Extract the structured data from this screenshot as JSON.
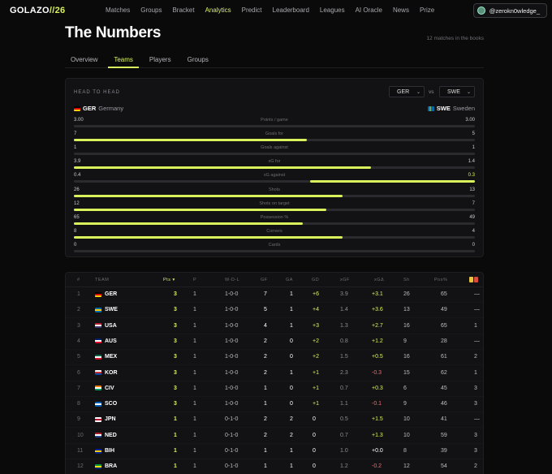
{
  "brand": {
    "main": "GOLAZO",
    "accent": "//26"
  },
  "nav": [
    "Matches",
    "Groups",
    "Bracket",
    "Analytics",
    "Predict",
    "Leaderboard",
    "Leagues",
    "AI Oracle",
    "News",
    "Prize"
  ],
  "nav_active": "Analytics",
  "user": {
    "handle": "@zerokn0wledge_"
  },
  "page": {
    "title": "The Numbers",
    "subtitle": "12 matches in the books"
  },
  "tabs": [
    "Overview",
    "Teams",
    "Players",
    "Groups"
  ],
  "tab_active": "Teams",
  "h2h": {
    "label": "HEAD TO HEAD",
    "vs": "vs",
    "left": {
      "code": "GER",
      "name": "Germany",
      "select": "GER"
    },
    "right": {
      "code": "SWE",
      "name": "Sweden",
      "select": "SWE"
    },
    "stats": [
      {
        "label": "Points / game",
        "left": "3.00",
        "right": "3.00",
        "left_share": 0.5,
        "right_share": 0.5,
        "highlight": "none"
      },
      {
        "label": "Goals for",
        "left": "7",
        "right": "5",
        "left_share": 0.58,
        "right_share": 0.42,
        "highlight": "left"
      },
      {
        "label": "Goals against",
        "left": "1",
        "right": "1",
        "left_share": 0.5,
        "right_share": 0.5,
        "highlight": "none"
      },
      {
        "label": "xG for",
        "left": "3.9",
        "right": "1.4",
        "left_share": 0.74,
        "right_share": 0.26,
        "highlight": "left"
      },
      {
        "label": "xG against",
        "left": "0.4",
        "right": "0.3",
        "left_share": 0.59,
        "right_share": 0.41,
        "highlight": "right"
      },
      {
        "label": "Shots",
        "left": "26",
        "right": "13",
        "left_share": 0.67,
        "right_share": 0.33,
        "highlight": "left"
      },
      {
        "label": "Shots on target",
        "left": "12",
        "right": "7",
        "left_share": 0.63,
        "right_share": 0.37,
        "highlight": "left"
      },
      {
        "label": "Possession %",
        "left": "65",
        "right": "49",
        "left_share": 0.57,
        "right_share": 0.43,
        "highlight": "left"
      },
      {
        "label": "Corners",
        "left": "8",
        "right": "4",
        "left_share": 0.67,
        "right_share": 0.33,
        "highlight": "left"
      },
      {
        "label": "Cards",
        "left": "0",
        "right": "0",
        "left_share": 0.5,
        "right_share": 0.5,
        "highlight": "none"
      }
    ]
  },
  "table": {
    "headers": {
      "rank": "#",
      "team": "TEAM",
      "pts": "Pts ▾",
      "p": "P",
      "wdl": "W-D-L",
      "gf": "GF",
      "ga": "GA",
      "gd": "GD",
      "xgf": "xGF",
      "xgd": "xGΔ",
      "sh": "Sh",
      "pos": "Pos%"
    },
    "rows": [
      {
        "rank": "1",
        "code": "GER",
        "flag": [
          "#000000",
          "#dd0000",
          "#ffce00"
        ],
        "pts": "3",
        "p": "1",
        "wdl": "1-0-0",
        "gf": "7",
        "ga": "1",
        "gd": "+6",
        "xgf": "3.9",
        "xgd": "+3.1",
        "sh": "26",
        "pos": "65",
        "cards": "—"
      },
      {
        "rank": "2",
        "code": "SWE",
        "flag": [
          "#006aa7",
          "#fecc00",
          "#006aa7"
        ],
        "pts": "3",
        "p": "1",
        "wdl": "1-0-0",
        "gf": "5",
        "ga": "1",
        "gd": "+4",
        "xgf": "1.4",
        "xgd": "+3.6",
        "sh": "13",
        "pos": "49",
        "cards": "—"
      },
      {
        "rank": "3",
        "code": "USA",
        "flag": [
          "#b22234",
          "#ffffff",
          "#3c3b6e"
        ],
        "pts": "3",
        "p": "1",
        "wdl": "1-0-0",
        "gf": "4",
        "ga": "1",
        "gd": "+3",
        "xgf": "1.3",
        "xgd": "+2.7",
        "sh": "16",
        "pos": "65",
        "cards": "1"
      },
      {
        "rank": "4",
        "code": "AUS",
        "flag": [
          "#012169",
          "#ffffff",
          "#e4002b"
        ],
        "pts": "3",
        "p": "1",
        "wdl": "1-0-0",
        "gf": "2",
        "ga": "0",
        "gd": "+2",
        "xgf": "0.8",
        "xgd": "+1.2",
        "sh": "9",
        "pos": "28",
        "cards": "—"
      },
      {
        "rank": "5",
        "code": "MEX",
        "flag": [
          "#006847",
          "#ffffff",
          "#ce1126"
        ],
        "pts": "3",
        "p": "1",
        "wdl": "1-0-0",
        "gf": "2",
        "ga": "0",
        "gd": "+2",
        "xgf": "1.5",
        "xgd": "+0.5",
        "sh": "16",
        "pos": "61",
        "cards": "2"
      },
      {
        "rank": "6",
        "code": "KOR",
        "flag": [
          "#ffffff",
          "#cd2e3a",
          "#0047a0"
        ],
        "pts": "3",
        "p": "1",
        "wdl": "1-0-0",
        "gf": "2",
        "ga": "1",
        "gd": "+1",
        "xgf": "2.3",
        "xgd": "-0.3",
        "sh": "15",
        "pos": "62",
        "cards": "1"
      },
      {
        "rank": "7",
        "code": "CIV",
        "flag": [
          "#f77f00",
          "#ffffff",
          "#009e60"
        ],
        "pts": "3",
        "p": "1",
        "wdl": "1-0-0",
        "gf": "1",
        "ga": "0",
        "gd": "+1",
        "xgf": "0.7",
        "xgd": "+0.3",
        "sh": "6",
        "pos": "45",
        "cards": "3"
      },
      {
        "rank": "8",
        "code": "SCO",
        "flag": [
          "#005eb8",
          "#ffffff",
          "#005eb8"
        ],
        "pts": "3",
        "p": "1",
        "wdl": "1-0-0",
        "gf": "1",
        "ga": "0",
        "gd": "+1",
        "xgf": "1.1",
        "xgd": "-0.1",
        "sh": "9",
        "pos": "46",
        "cards": "3"
      },
      {
        "rank": "9",
        "code": "JPN",
        "flag": [
          "#ffffff",
          "#bc002d",
          "#ffffff"
        ],
        "pts": "1",
        "p": "1",
        "wdl": "0-1-0",
        "gf": "2",
        "ga": "2",
        "gd": "0",
        "xgf": "0.5",
        "xgd": "+1.5",
        "sh": "10",
        "pos": "41",
        "cards": "—"
      },
      {
        "rank": "10",
        "code": "NED",
        "flag": [
          "#ae1c28",
          "#ffffff",
          "#21468b"
        ],
        "pts": "1",
        "p": "1",
        "wdl": "0-1-0",
        "gf": "2",
        "ga": "2",
        "gd": "0",
        "xgf": "0.7",
        "xgd": "+1.3",
        "sh": "10",
        "pos": "59",
        "cards": "3"
      },
      {
        "rank": "11",
        "code": "BIH",
        "flag": [
          "#002395",
          "#fecb00",
          "#002395"
        ],
        "pts": "1",
        "p": "1",
        "wdl": "0-1-0",
        "gf": "1",
        "ga": "1",
        "gd": "0",
        "xgf": "1.0",
        "xgd": "+0.0",
        "sh": "8",
        "pos": "39",
        "cards": "3"
      },
      {
        "rank": "12",
        "code": "BRA",
        "flag": [
          "#009c3b",
          "#ffdf00",
          "#002776"
        ],
        "pts": "1",
        "p": "1",
        "wdl": "0-1-0",
        "gf": "1",
        "ga": "1",
        "gd": "0",
        "xgf": "1.2",
        "xgd": "-0.2",
        "sh": "12",
        "pos": "54",
        "cards": "2"
      }
    ]
  },
  "colors": {
    "accent": "#d9f25c",
    "negative": "#f06a6a",
    "bg": "#0a0a0b",
    "card": "#121215"
  }
}
